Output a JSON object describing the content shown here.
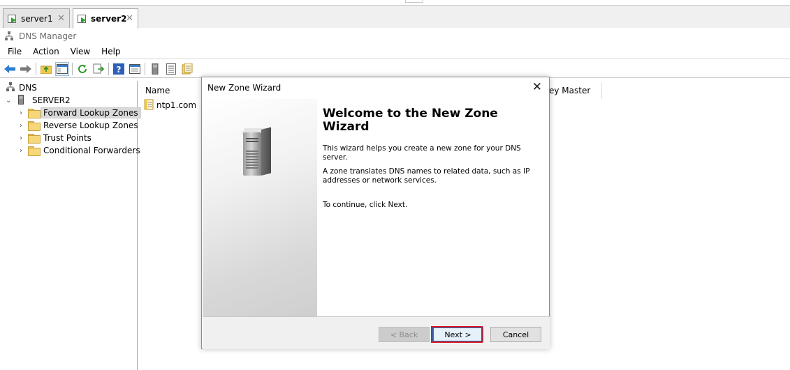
{
  "tabs": [
    {
      "label": "server1",
      "active": false
    },
    {
      "label": "server2",
      "active": true
    }
  ],
  "window": {
    "title": "DNS Manager"
  },
  "menu": [
    "File",
    "Action",
    "View",
    "Help"
  ],
  "tree": {
    "root": "DNS",
    "server": "SERVER2",
    "children": [
      "Forward Lookup Zones",
      "Reverse Lookup Zones",
      "Trust Points",
      "Conditional Forwarders"
    ],
    "selected": "Forward Lookup Zones"
  },
  "list": {
    "columns": [
      "Name",
      "ey Master"
    ],
    "items": [
      "ntp1.com"
    ]
  },
  "wizard": {
    "title": "New Zone Wizard",
    "heading": "Welcome to the New Zone Wizard",
    "para1": "This wizard helps you create a new zone for your DNS server.",
    "para2": "A zone translates DNS names to related data, such as IP addresses or network services.",
    "para3": "To continue, click Next.",
    "back_label": "< Back",
    "next_label": "Next >",
    "cancel_label": "Cancel"
  },
  "colors": {
    "accent": "#0078d7",
    "highlight": "#e0141e",
    "folder": "#f6d77a"
  }
}
